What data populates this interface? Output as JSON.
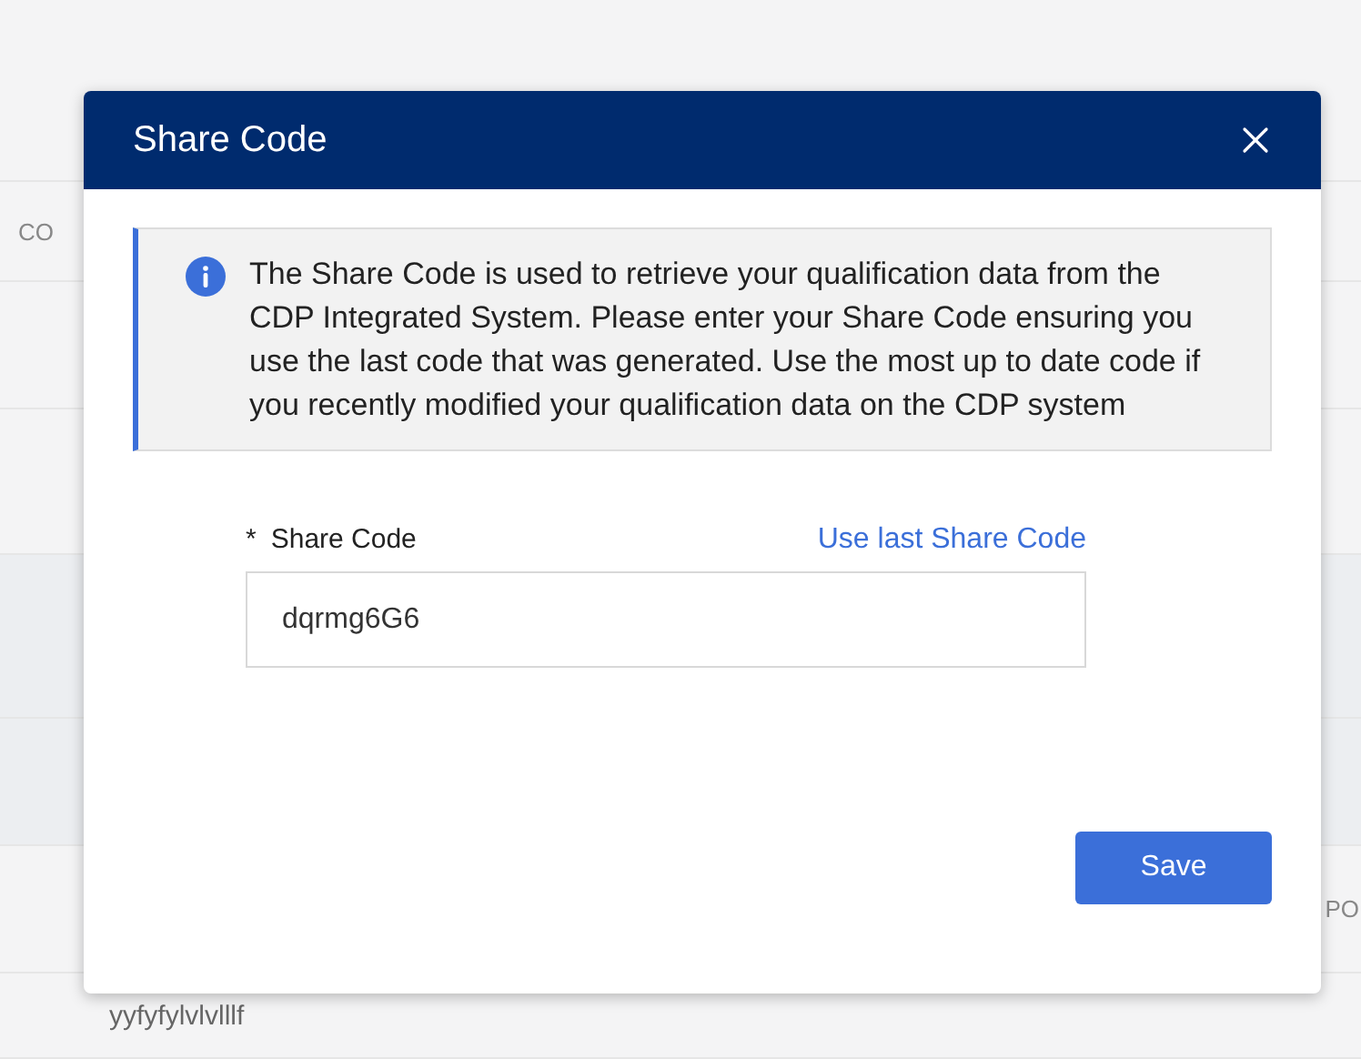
{
  "background": {
    "left_fragment": "CO",
    "right_fragment": "PO",
    "bottom_cell": "yyfyfylvlvlllf"
  },
  "dialog": {
    "title": "Share Code",
    "info": "The Share Code is used to retrieve your qualification data from the CDP Integrated System. Please enter your Share Code ensuring you use the last code that was generated. Use the most up to date code if you recently modified your qualification data on the CDP system",
    "field": {
      "required_mark": "*",
      "label": "Share Code",
      "link": "Use last Share Code",
      "value": "dqrmg6G6"
    },
    "button": "Save"
  }
}
